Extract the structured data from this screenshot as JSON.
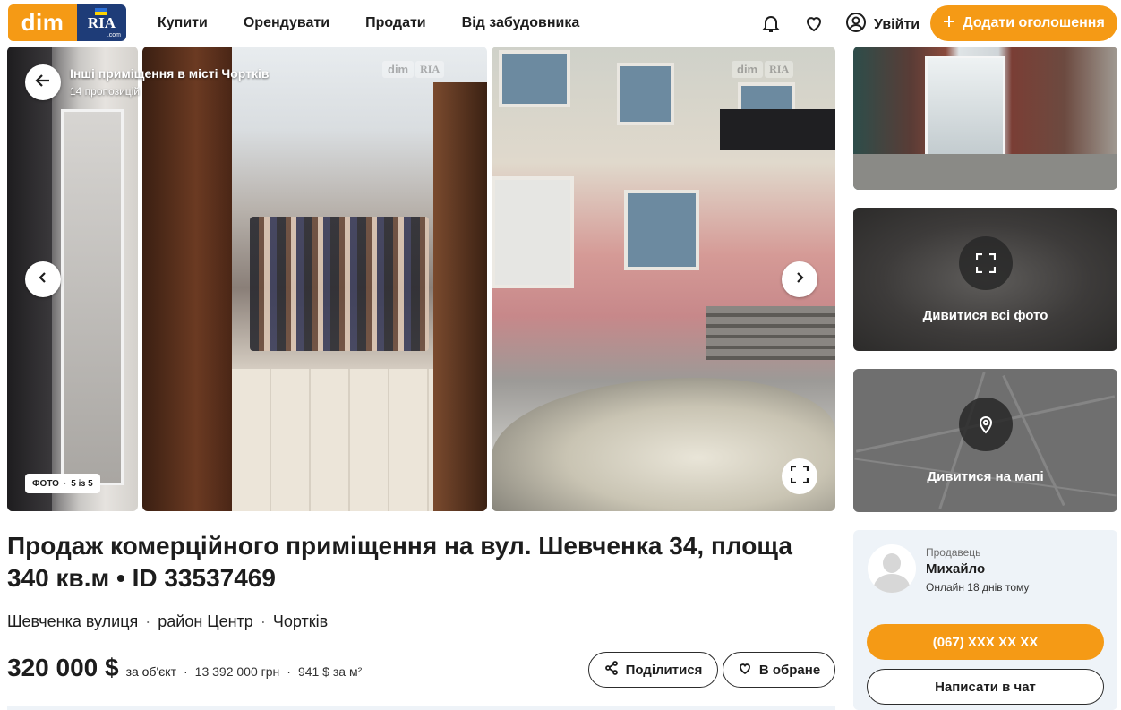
{
  "header": {
    "logo_dim": "dim",
    "logo_ria": "RIA",
    "logo_ria_suffix": ".com",
    "nav": [
      "Купити",
      "Орендувати",
      "Продати",
      "Від забудовника"
    ],
    "login_label": "Увійти",
    "add_label": "Додати оголошення",
    "accent": "#f59a15"
  },
  "gallery": {
    "title": "Інші приміщення в місті Чортків",
    "subtitle": "14 пропозицій",
    "counter_label": "ФОТО",
    "counter_value": "5 із 5",
    "watermark_dim": "dim",
    "watermark_ria": "RIA"
  },
  "side": {
    "all_photos_label": "Дивитися всі фото",
    "map_label": "Дивитися на мапі"
  },
  "listing": {
    "title": "Продаж комерційного приміщення на вул. Шевченка 34, площа 340 кв.м • ID 33537469",
    "address": [
      "Шевченка вулиця",
      "район Центр",
      "Чортків"
    ],
    "price": "320 000 $",
    "price_unit": "за об'єкт",
    "price_uah": "13 392 000 грн",
    "price_per_m2": "941 $ за м²",
    "share_label": "Поділитися",
    "favorite_label": "В обране"
  },
  "seller": {
    "role": "Продавець",
    "name": "Михайло",
    "online": "Онлайн 18 днів тому",
    "phone_label": "(067) XXX XX XX",
    "chat_label": "Написати в чат"
  }
}
